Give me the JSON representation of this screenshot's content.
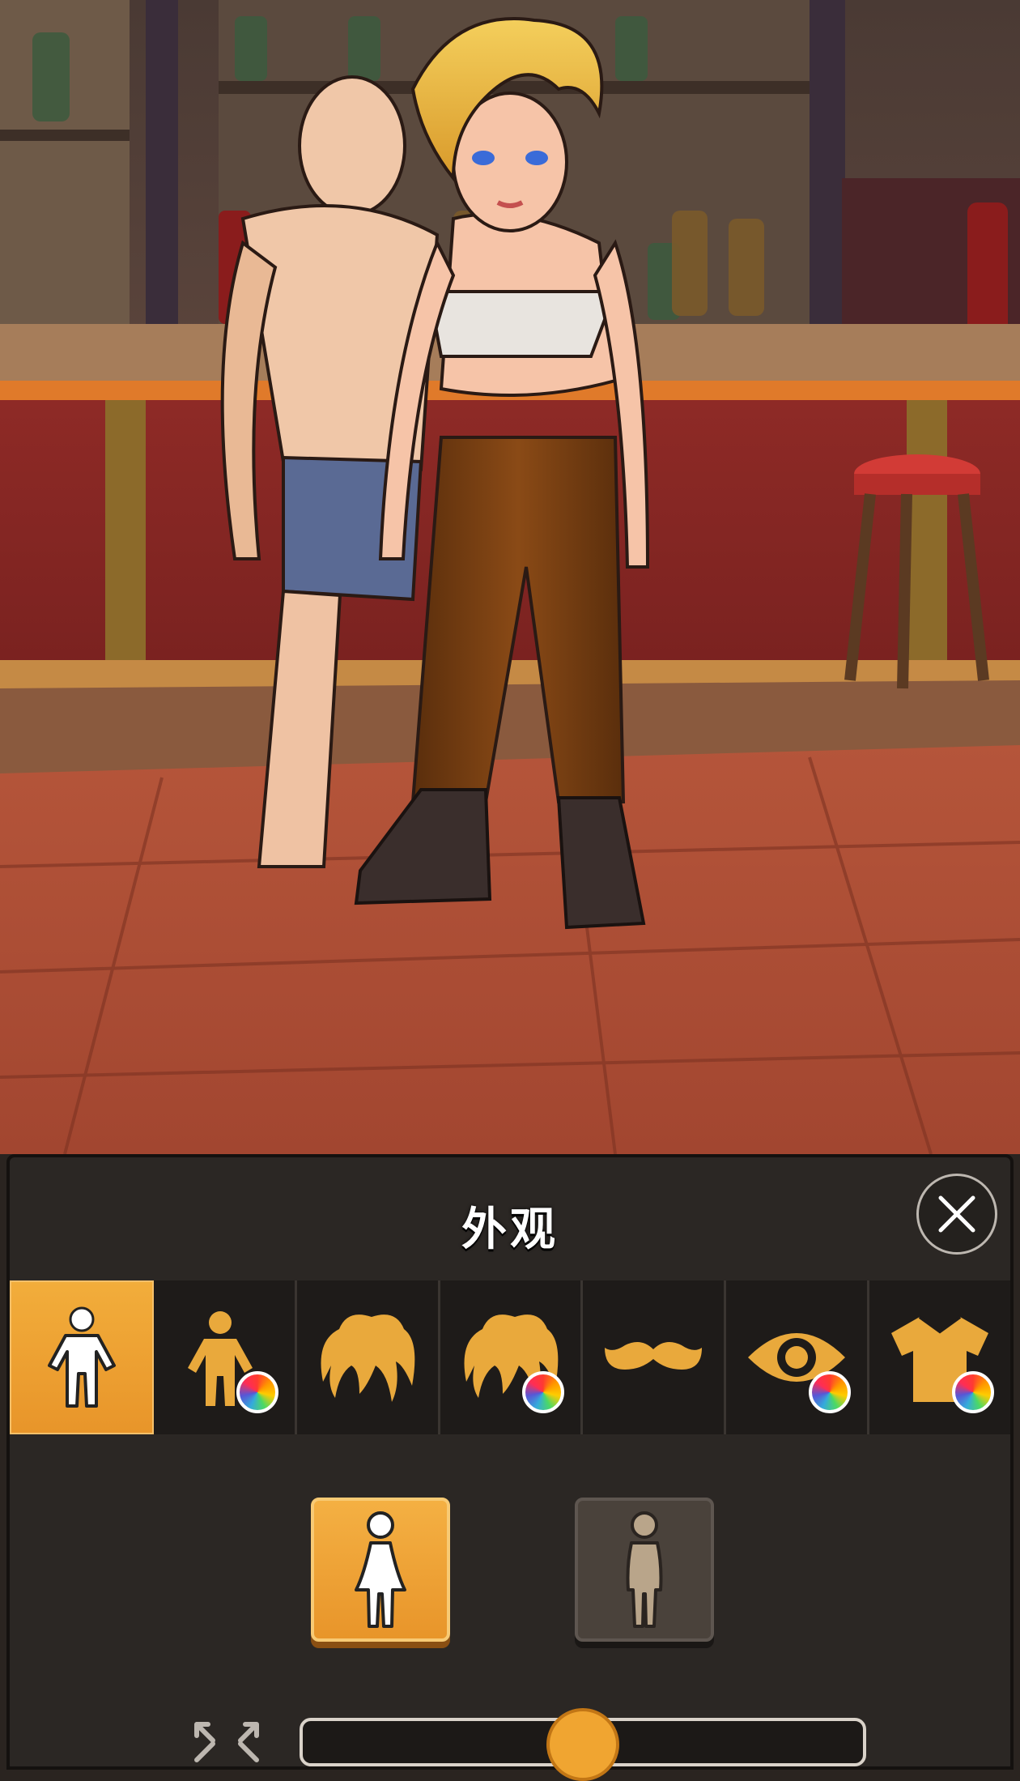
{
  "panel": {
    "title": "外观",
    "close_icon": "close-icon"
  },
  "tabs": [
    {
      "icon": "body-icon",
      "active": true,
      "color_wheel": false
    },
    {
      "icon": "skin-color-icon",
      "active": false,
      "color_wheel": true
    },
    {
      "icon": "hair-icon",
      "active": false,
      "color_wheel": false
    },
    {
      "icon": "hair-color-icon",
      "active": false,
      "color_wheel": true
    },
    {
      "icon": "mustache-icon",
      "active": false,
      "color_wheel": false
    },
    {
      "icon": "eye-color-icon",
      "active": false,
      "color_wheel": true
    },
    {
      "icon": "shirt-color-icon",
      "active": false,
      "color_wheel": true
    }
  ],
  "gender": {
    "selected": "female",
    "options": [
      "female-icon",
      "male-icon"
    ]
  },
  "size_slider": {
    "icon": "resize-icon",
    "value": 0.5
  },
  "colors": {
    "accent": "#e8952a",
    "panel_bg": "#2b2724",
    "tab_bg": "#1e1b19"
  }
}
